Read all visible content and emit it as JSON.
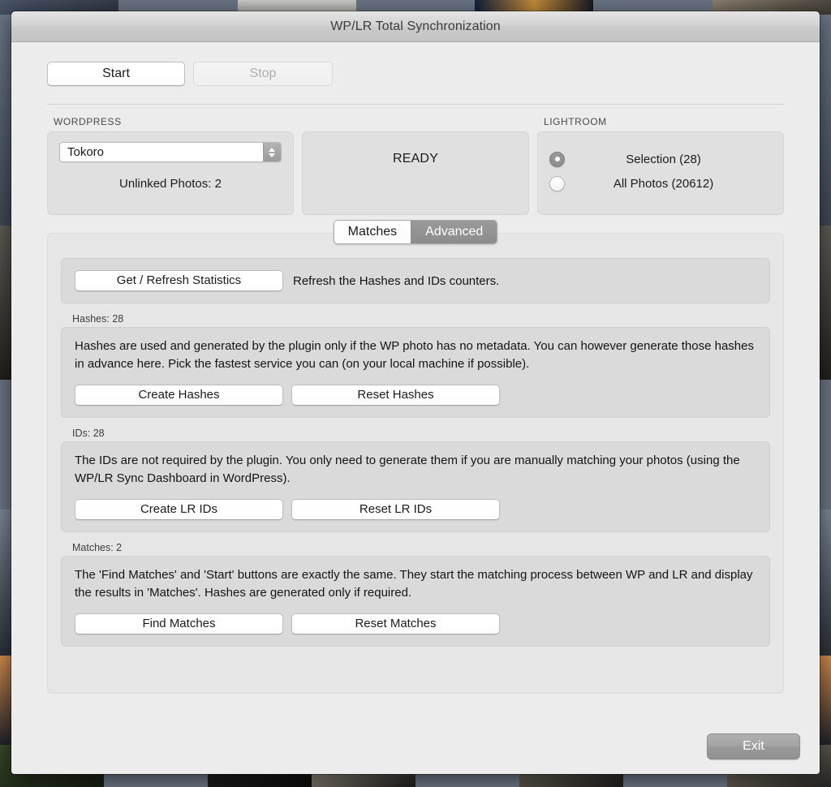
{
  "window": {
    "title": "WP/LR Total Synchronization"
  },
  "toolbar": {
    "start_label": "Start",
    "stop_label": "Stop"
  },
  "wordpress": {
    "group_label": "WORDPRESS",
    "selected_collection": "Tokoro",
    "stepper_icon": "up-down-chevron-icon",
    "unlinked_photos": "Unlinked Photos: 2"
  },
  "status": {
    "text": "READY"
  },
  "lightroom": {
    "group_label": "LIGHTROOM",
    "options": [
      {
        "label": "Selection (28)",
        "selected": true
      },
      {
        "label": "All Photos (20612)",
        "selected": false
      }
    ]
  },
  "tabs": [
    {
      "label": "Matches",
      "active": false
    },
    {
      "label": "Advanced",
      "active": true
    }
  ],
  "advanced": {
    "statistics": {
      "button_label": "Get / Refresh Statistics",
      "hint": "Refresh the Hashes and IDs counters."
    },
    "sections": [
      {
        "title": "Hashes: 28",
        "description": "Hashes are used and generated by the plugin only if the WP photo has no metadata. You can however generate those hashes in advance here. Pick the fastest service you can (on your local machine if possible).",
        "create_label": "Create Hashes",
        "reset_label": "Reset Hashes"
      },
      {
        "title": "IDs: 28",
        "description": "The IDs are not required by the plugin. You only need to generate them if you are manually matching your photos (using the WP/LR Sync Dashboard in WordPress).",
        "create_label": "Create LR IDs",
        "reset_label": "Reset LR IDs"
      },
      {
        "title": "Matches: 2",
        "description": "The 'Find Matches' and 'Start' buttons are exactly the same. They start the matching process between WP and LR and display the results in 'Matches'. Hashes are generated only if required.",
        "create_label": "Find Matches",
        "reset_label": "Reset Matches"
      }
    ]
  },
  "footer": {
    "exit_label": "Exit"
  },
  "colors": {
    "dialog_background": "#ececec",
    "panel_background": "#e0e0e0",
    "card_background": "#dadada",
    "active_tab": "#8c8c8c",
    "exit_button": "#9a9a9a"
  }
}
